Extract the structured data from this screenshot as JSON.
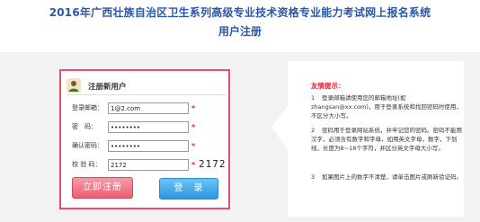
{
  "header": {
    "title": "2016年广西壮族自治区卫生系列高级专业技术资格专业能力考试网上报名系统",
    "subtitle": "用户注册"
  },
  "form": {
    "heading": "注册新用户",
    "fields": [
      {
        "label": "登录邮箱：",
        "value": "1@2.com",
        "type": "text"
      },
      {
        "label": "密　码：",
        "value": "12345678",
        "type": "password"
      },
      {
        "label": "确认密码：",
        "value": "12345678",
        "type": "password"
      },
      {
        "label": "校 验 码：",
        "value": "2172",
        "type": "text"
      }
    ],
    "required_mark": "*",
    "captcha_text": "2172",
    "register_label": "立即注册",
    "login_label": "登　录"
  },
  "tips": {
    "title": "友情提示：",
    "items": [
      {
        "num": "1",
        "text": "登录邮箱请使用您的邮箱地址(如zhangsan@xx.com)，用于登录系统和找回密码时使用，不区分大小写。"
      },
      {
        "num": "2",
        "text": "密码用于登录网站系统，并牢记您的密码。密码不能用汉字，必须含有数字和字母，如用英文字母，数字，下划线，长度为8~18个字符，并区分英文字母大小写。"
      },
      {
        "num": "3",
        "text": "如果图片上的数字不清楚，请单击图片或刷新验证码。"
      }
    ]
  },
  "colors": {
    "title_blue": "#2a57a6",
    "panel_border": "#ea4d6a",
    "required_red": "#e0263c",
    "register_button": "#ea5f72",
    "login_button": "#2a97e0"
  },
  "icons": {
    "user": "user-icon"
  }
}
